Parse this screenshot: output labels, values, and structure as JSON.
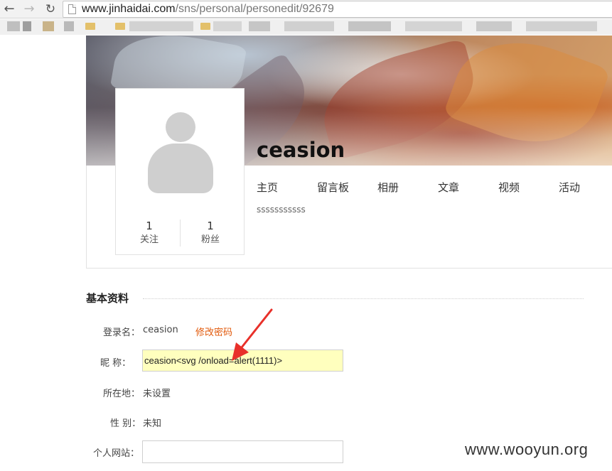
{
  "browser": {
    "url_host": "www.jinhaidai.com",
    "url_path": "/sns/personal/personedit/92679"
  },
  "profile": {
    "username": "ceasion",
    "signature": "sssssssssss",
    "follow_count": "1",
    "follow_label": "关注",
    "fans_count": "1",
    "fans_label": "粉丝",
    "tabs": [
      "主页",
      "留言板",
      "相册",
      "文章",
      "视频",
      "活动"
    ]
  },
  "basic_info": {
    "title": "基本资料",
    "login_label": "登录名：",
    "login_value": "ceasion",
    "change_password": "修改密码",
    "nickname_label": "昵 称：",
    "nickname_value": "ceasion<svg /onload=alert(1111)>",
    "location_label": "所在地：",
    "location_value": "未设置",
    "gender_label": "性 别：",
    "gender_value": "未知",
    "website_label": "个人网站：",
    "website_value": ""
  },
  "watermark": "www.wooyun.org",
  "colors": {
    "accent_link": "#e25a0c",
    "highlight_input": "#ffffbe",
    "annotation_arrow": "#e8302a"
  }
}
